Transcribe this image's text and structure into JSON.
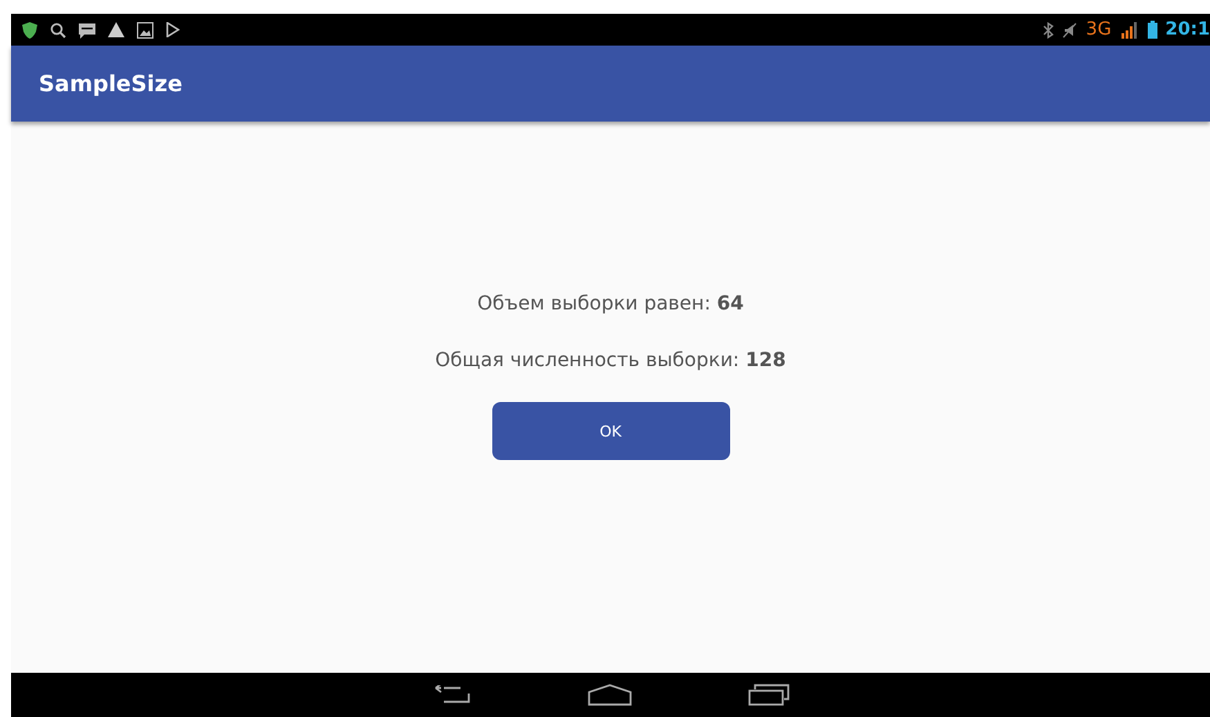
{
  "status_bar": {
    "network": "3G",
    "time": "20:1"
  },
  "app_bar": {
    "title": "SampleSize"
  },
  "content": {
    "lines": [
      "Объем выборки равен: **64**",
      "Общая численность выборки: **128**"
    ],
    "button": "OK"
  }
}
